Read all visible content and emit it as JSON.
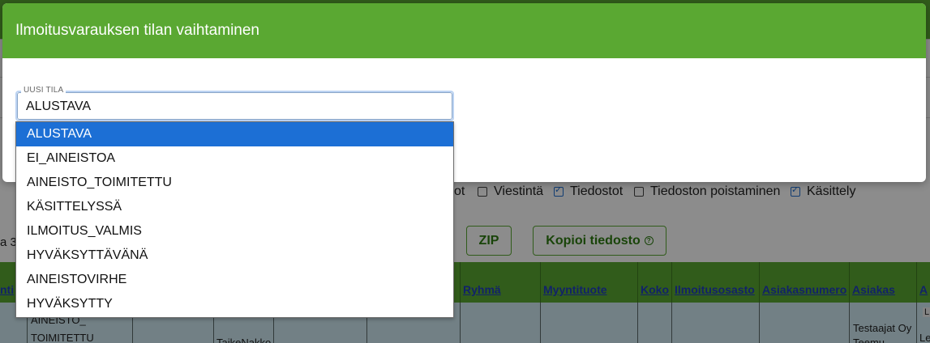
{
  "modal": {
    "title": "Ilmoitusvarauksen tilan vaihtaminen",
    "field_label": "UUSI TILA",
    "field_value": "ALUSTAVA",
    "options": [
      "ALUSTAVA",
      "EI_AINEISTOA",
      "AINEISTO_TOIMITETTU",
      "KÄSITTELYSSÄ",
      "ILMOITUS_VALMIS",
      "HYVÄKSYTTÄVÄNÄ",
      "AINEISTOVIRHE",
      "HYVÄKSYTTY"
    ],
    "selected_index": 0
  },
  "background": {
    "filters": [
      {
        "label": "ot",
        "checked": null
      },
      {
        "label": "Viestintä",
        "checked": false
      },
      {
        "label": "Tiedostot",
        "checked": true
      },
      {
        "label": "Tiedoston poistaminen",
        "checked": false
      },
      {
        "label": "Käsittely",
        "checked": true
      }
    ],
    "row_prefix": "a 3",
    "zip_label": "ZIP",
    "copy_label": "Kopioi tiedosto",
    "columns": [
      "nti",
      "Ryhmä",
      "Myyntituote",
      "Koko",
      "Ilmoitusosasto",
      "Asiakasnumero",
      "Asiakas",
      "A"
    ],
    "row": {
      "status_line1": "AINEISTO_",
      "status_line2": "TOIMITETTU",
      "product": "TaikeNakko",
      "customer_line1": "Testaajat Oy",
      "customer_line2": "Teemu",
      "last_col_top": "L",
      "last_col_bottom": "Le"
    }
  },
  "colors": {
    "brand_green": "#5aa832",
    "selection_blue": "#1c6fd5"
  }
}
